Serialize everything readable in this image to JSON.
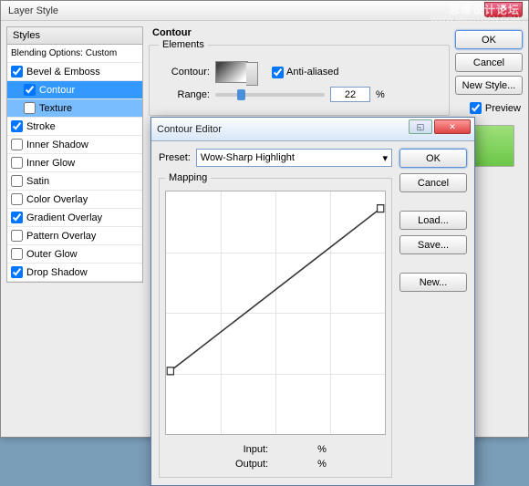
{
  "watermark": {
    "line1": "思缘设计论坛",
    "line2": "WWW.MISSYUAN.COM"
  },
  "main": {
    "title": "Layer Style",
    "styles_header": "Styles",
    "blending": "Blending Options: Custom",
    "items": [
      {
        "label": "Bevel & Emboss",
        "checked": true
      },
      {
        "label": "Contour",
        "checked": true,
        "sub": true,
        "selected": true
      },
      {
        "label": "Texture",
        "checked": false,
        "sub": true,
        "highlighted": true
      },
      {
        "label": "Stroke",
        "checked": true
      },
      {
        "label": "Inner Shadow",
        "checked": false
      },
      {
        "label": "Inner Glow",
        "checked": false
      },
      {
        "label": "Satin",
        "checked": false
      },
      {
        "label": "Color Overlay",
        "checked": false
      },
      {
        "label": "Gradient Overlay",
        "checked": true
      },
      {
        "label": "Pattern Overlay",
        "checked": false
      },
      {
        "label": "Outer Glow",
        "checked": false
      },
      {
        "label": "Drop Shadow",
        "checked": true
      }
    ],
    "contour_group": "Contour",
    "elements_group": "Elements",
    "contour_label": "Contour:",
    "aa_label": "Anti-aliased",
    "aa_checked": true,
    "range_label": "Range:",
    "range_value": "22",
    "range_unit": "%",
    "buttons": {
      "ok": "OK",
      "cancel": "Cancel",
      "newstyle": "New Style...",
      "preview": "Preview",
      "preview_checked": true
    }
  },
  "ce": {
    "title": "Contour Editor",
    "preset_label": "Preset:",
    "preset_value": "Wow-Sharp Highlight",
    "mapping_label": "Mapping",
    "input_label": "Input:",
    "output_label": "Output:",
    "input_value": "",
    "output_value": "",
    "unit": "%",
    "buttons": {
      "ok": "OK",
      "cancel": "Cancel",
      "load": "Load...",
      "save": "Save...",
      "new": "New..."
    }
  }
}
